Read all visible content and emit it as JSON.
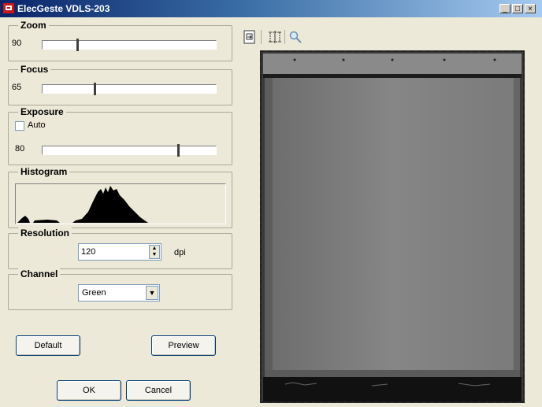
{
  "window": {
    "title": "ElecGeste VDLS-203",
    "minimize": "_",
    "maximize": "□",
    "close": "×"
  },
  "zoom": {
    "label": "Zoom",
    "value": "90",
    "level": 0.2
  },
  "focus": {
    "label": "Focus",
    "value": "65",
    "level": 0.3
  },
  "exposure": {
    "label": "Exposure",
    "auto_label": "Auto",
    "auto_checked": false,
    "value": "80",
    "level": 0.79
  },
  "histogram": {
    "label": "Histogram"
  },
  "resolution": {
    "label": "Resolution",
    "value": "120",
    "unit": "dpi"
  },
  "channel": {
    "label": "Channel",
    "selected": "Green"
  },
  "buttons": {
    "default": "Default",
    "preview": "Preview",
    "ok": "OK",
    "cancel": "Cancel"
  },
  "toolbar": {
    "tools": [
      "fit-page-icon",
      "crop-select-icon",
      "magnifier-icon"
    ]
  },
  "colors": {
    "title_bar": "#0a246a",
    "panel_bg": "#ece9d8",
    "preview_plate": "#7a7a7a"
  }
}
